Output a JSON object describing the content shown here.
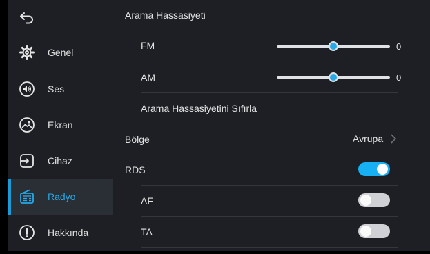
{
  "sidebar": {
    "back_icon": "back-arrow-icon",
    "items": [
      {
        "label": "Genel",
        "icon": "gear-icon",
        "active": false
      },
      {
        "label": "Ses",
        "icon": "speaker-icon",
        "active": false
      },
      {
        "label": "Ekran",
        "icon": "display-icon",
        "active": false
      },
      {
        "label": "Cihaz",
        "icon": "device-icon",
        "active": false
      },
      {
        "label": "Radyo",
        "icon": "radio-icon",
        "active": true
      },
      {
        "label": "Hakkında",
        "icon": "info-icon",
        "active": false
      }
    ]
  },
  "main": {
    "search_sensitivity": {
      "title": "Arama Hassasiyeti",
      "fm": {
        "label": "FM",
        "value": "0",
        "level": 0.5
      },
      "am": {
        "label": "AM",
        "value": "0",
        "level": 0.5
      },
      "reset_label": "Arama Hassasiyetini Sıfırla"
    },
    "region": {
      "label": "Bölge",
      "value": "Avrupa"
    },
    "rds": {
      "label": "RDS",
      "on": true
    },
    "af": {
      "label": "AF",
      "on": false
    },
    "ta": {
      "label": "TA",
      "on": false
    }
  },
  "colors": {
    "accent": "#1b9ad8",
    "toggle_on": "#17b0f2",
    "toggle_off": "#cfd1d4",
    "panel": "#1d1f24"
  }
}
